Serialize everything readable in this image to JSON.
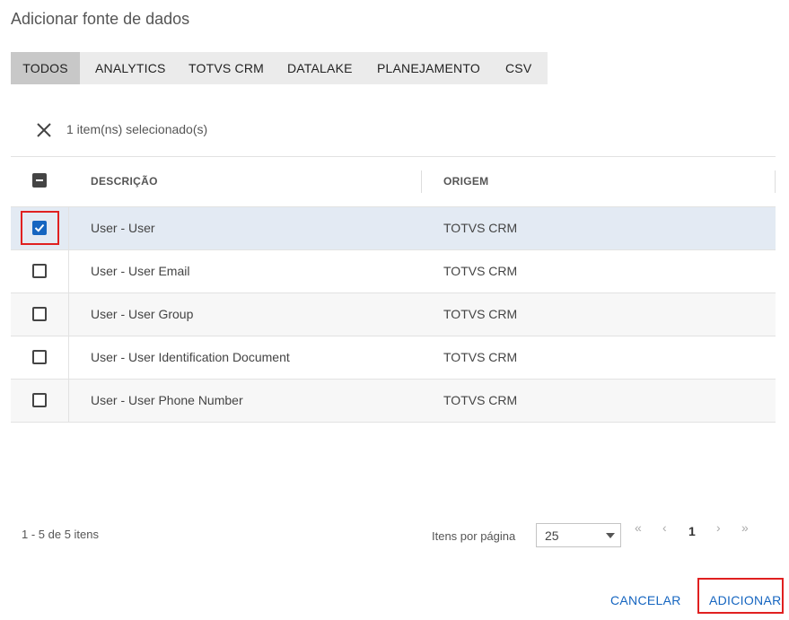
{
  "dialog": {
    "title": "Adicionar fonte de dados"
  },
  "tabs": [
    "TODOS",
    "ANALYTICS",
    "TOTVS CRM",
    "DATALAKE",
    "PLANEJAMENTO",
    "CSV"
  ],
  "selection": {
    "text": "1 item(ns) selecionado(s)"
  },
  "table": {
    "headers": {
      "description": "DESCRIÇÃO",
      "origin": "ORIGEM"
    },
    "rows": [
      {
        "description": "User - User",
        "origin": "TOTVS CRM",
        "checked": true
      },
      {
        "description": "User - User Email",
        "origin": "TOTVS CRM",
        "checked": false
      },
      {
        "description": "User - User Group",
        "origin": "TOTVS CRM",
        "checked": false
      },
      {
        "description": "User - User Identification Document",
        "origin": "TOTVS CRM",
        "checked": false
      },
      {
        "description": "User - User Phone Number",
        "origin": "TOTVS CRM",
        "checked": false
      }
    ]
  },
  "pagination": {
    "range_text": "1 - 5 de 5 itens",
    "items_per_page_label": "Itens por página",
    "items_per_page_value": "25",
    "first": "«",
    "prev": "‹",
    "current_page": "1",
    "next": "›",
    "last": "»"
  },
  "actions": {
    "cancel": "CANCELAR",
    "add": "ADICIONAR"
  },
  "colors": {
    "accent": "#1565c0",
    "selected_row": "#e3eaf3",
    "highlight": "#e02020"
  }
}
